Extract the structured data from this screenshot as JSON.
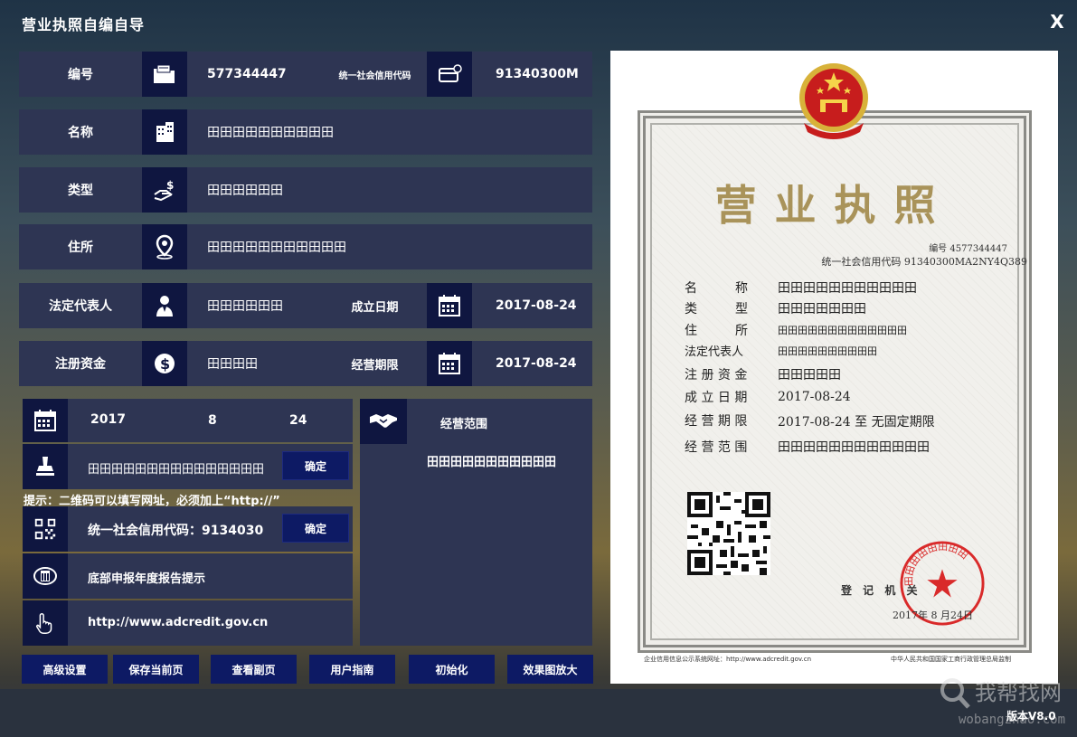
{
  "app": {
    "title": "营业执照自编自导",
    "close_label": "X"
  },
  "form": {
    "number": {
      "label": "编号",
      "value": "577344447"
    },
    "credit_code": {
      "label": "统一社会信用代码",
      "value": "91340300M"
    },
    "name": {
      "label": "名称",
      "value": "田田田田田田田田田田"
    },
    "type": {
      "label": "类型",
      "value": "田田田田田田"
    },
    "address": {
      "label": "住所",
      "value": "田田田田田田田田田田田"
    },
    "legal_rep": {
      "label": "法定代表人",
      "value": "田田田田田田"
    },
    "found_date": {
      "label": "成立日期",
      "value": "2017-08-24"
    },
    "capital": {
      "label": "注册资金",
      "value": "田田田田"
    },
    "term": {
      "label": "经营期限",
      "value": "2017-08-24"
    }
  },
  "left_panel": {
    "year": "2017",
    "month": "8",
    "day": "24",
    "authority_text": "田田田田田田田田田田田田田田田",
    "confirm_label": "确定",
    "hint": "提示：二维码可以填写网址，必须加上“http://”",
    "qr_text": "统一社会信用代码：9134030",
    "qr_confirm_label": "确定",
    "notice_text": "底部申报年度报告提示",
    "url_text": "http://www.adcredit.gov.cn"
  },
  "scope_panel": {
    "title": "经营范围",
    "value": "田田田田田田田田田田田"
  },
  "buttons": [
    "高级设置",
    "保存当前页",
    "查看副页",
    "用户指南",
    "初始化",
    "效果图放大"
  ],
  "version": "版本V8.0",
  "watermark": {
    "main": "我帮找网",
    "sub": "wobangzhao.com"
  },
  "certificate": {
    "title": "营业执照",
    "number_line": "编号 4577344447",
    "credit_line": "统一社会信用代码 91340300MA2NY4Q389",
    "fields": [
      {
        "label": "名　　　称",
        "value": "田田田田田田田田田田田"
      },
      {
        "label": "类　　　型",
        "value": "田田田田田田田"
      },
      {
        "label": "住　　　所",
        "value": "田田田田田田田田田田田田田"
      },
      {
        "label": "法定代表人",
        "value": "田田田田田田田田田田"
      },
      {
        "label": "注 册 资 金",
        "value": "田田田田田"
      },
      {
        "label": "成 立 日 期",
        "value": "2017-08-24"
      },
      {
        "label": "经 营 期 限",
        "value": "2017-08-24 至 无固定期限"
      },
      {
        "label": "经 营 范 围",
        "value": "田田田田田田田田田田田田"
      }
    ],
    "seal_text": "田田田田田田田田",
    "registration_authority": "登 记 机 关",
    "registration_date": "2017年 8 月24日",
    "footer_left": "企业信用信息公示系统网址：http://www.adcredit.gov.cn",
    "footer_right": "中华人民共和国国家工商行政管理总局监制"
  }
}
